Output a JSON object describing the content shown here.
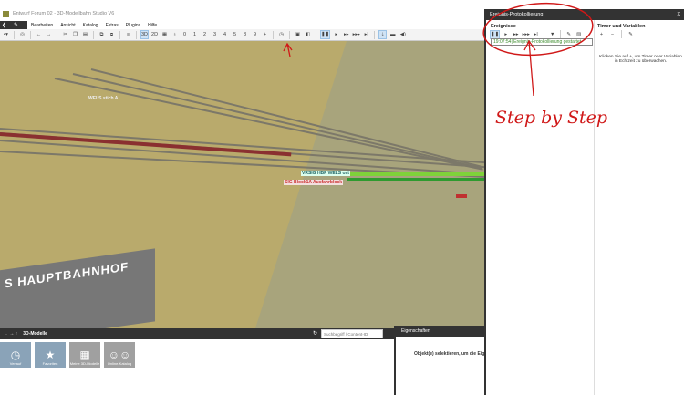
{
  "window": {
    "title": "Entwurf Forum 02 - 3D-Modellbahn Studio V6"
  },
  "menu": [
    "Bearbeiten",
    "Ansicht",
    "Katalog",
    "Extras",
    "Plugins",
    "Hilfe"
  ],
  "toolbar": {
    "view_3d": "3D",
    "view_2d": "2D",
    "layers": [
      "0",
      "1",
      "2",
      "3",
      "4",
      "5",
      "8",
      "9",
      "+"
    ]
  },
  "scene": {
    "labels": [
      "WELS stich A",
      "VRSIG  HBF WELS ost",
      "SIG Block1A  Ausfahrblock"
    ],
    "sign": "S HAUPTBAHNHOF"
  },
  "bottom": {
    "title": "3D-Modelle",
    "search_placeholder": "Suchbegriff / Content-ID",
    "tiles": [
      "Verlauf",
      "Favoriten",
      "Meine 3D-Modelle",
      "Online-Katalog"
    ]
  },
  "properties": {
    "title": "Eigenschaften",
    "message": "Objekt(e) selektieren, um die Eigenschaften"
  },
  "event_panel": {
    "title": "Ereignis-Protokollierung",
    "close": "X",
    "events_title": "Ereignisse",
    "log": [
      "19:07:54| Ereignis-Protokollierung gestartet"
    ],
    "timers_title": "Timer und Variablen",
    "timers_hint": "Klicken Sie auf +, um Timer oder Variablen in Echtzeit zu überwachen."
  },
  "annotation": {
    "text": "Step by Step"
  }
}
